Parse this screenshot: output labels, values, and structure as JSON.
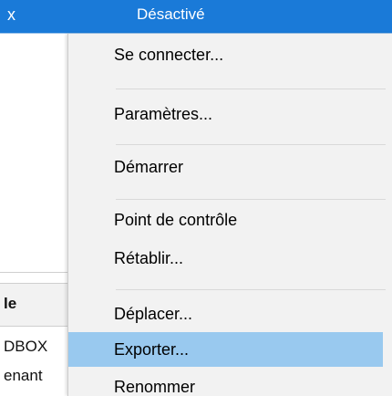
{
  "selected_row": {
    "left_text": "x",
    "state": "Désactivé"
  },
  "background_list": {
    "header": "le",
    "rows": [
      "DBOX",
      "enant"
    ]
  },
  "context_menu": {
    "items": [
      {
        "label": "Se connecter..."
      },
      {
        "label": "Paramètres..."
      },
      {
        "label": "Démarrer"
      },
      {
        "label": "Point de contrôle"
      },
      {
        "label": "Rétablir..."
      },
      {
        "label": "Déplacer..."
      },
      {
        "label": "Exporter...",
        "state": "hover"
      },
      {
        "label": "Renommer"
      }
    ]
  },
  "colors": {
    "selection": "#1a7ad8",
    "menu_hover": "#99c9ef",
    "menu_background": "#f2f2f2"
  }
}
